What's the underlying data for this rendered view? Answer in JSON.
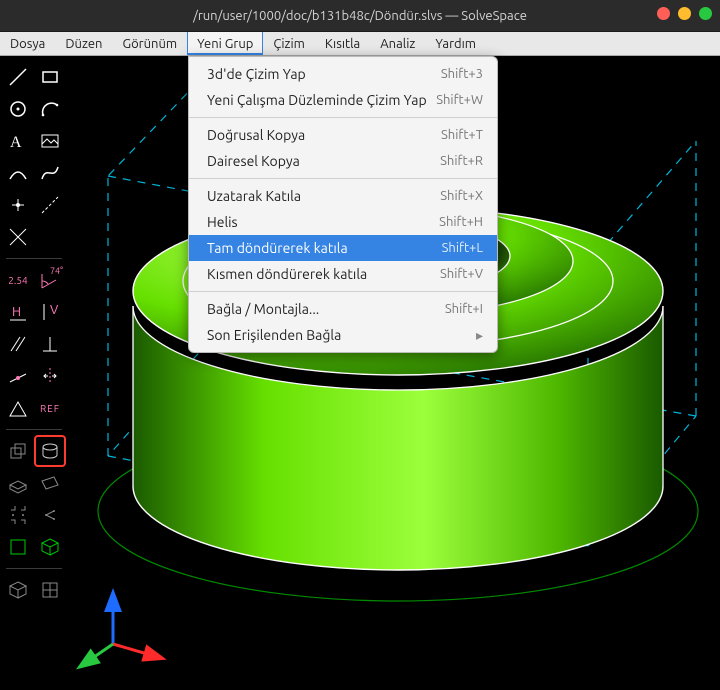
{
  "title": "/run/user/1000/doc/b131b48c/Döndür.slvs — SolveSpace",
  "menubar": {
    "items": [
      {
        "label": "Dosya"
      },
      {
        "label": "Düzen"
      },
      {
        "label": "Görünüm"
      },
      {
        "label": "Yeni Grup"
      },
      {
        "label": "Çizim"
      },
      {
        "label": "Kısıtla"
      },
      {
        "label": "Analiz"
      },
      {
        "label": "Yardım"
      }
    ],
    "open_index": 3
  },
  "dropdown": {
    "items": [
      {
        "label": "3d'de Çizim Yap",
        "accel": "Shift+3"
      },
      {
        "label": "Yeni Çalışma Düzleminde Çizim Yap",
        "accel": "Shift+W"
      },
      {
        "sep": true
      },
      {
        "label": "Doğrusal Kopya",
        "accel": "Shift+T"
      },
      {
        "label": "Dairesel Kopya",
        "accel": "Shift+R"
      },
      {
        "sep": true
      },
      {
        "label": "Uzatarak Katıla",
        "accel": "Shift+X"
      },
      {
        "label": "Helis",
        "accel": "Shift+H"
      },
      {
        "label": "Tam döndürerek katıla",
        "accel": "Shift+L",
        "highlight": true
      },
      {
        "label": "Kısmen döndürerek katıla",
        "accel": "Shift+V"
      },
      {
        "sep": true
      },
      {
        "label": "Bağla / Montajla...",
        "accel": "Shift+I"
      },
      {
        "label": "Son Erişilenden Bağla",
        "submenu": true
      }
    ]
  },
  "toolbar": {
    "dim_a": "2.54",
    "dim_b": "74°"
  },
  "colors": {
    "white": "#ffffff",
    "green": "#66ff00",
    "cyan": "#00eaff",
    "pink": "#ff7ab8",
    "toolred": "#ff3b30"
  }
}
